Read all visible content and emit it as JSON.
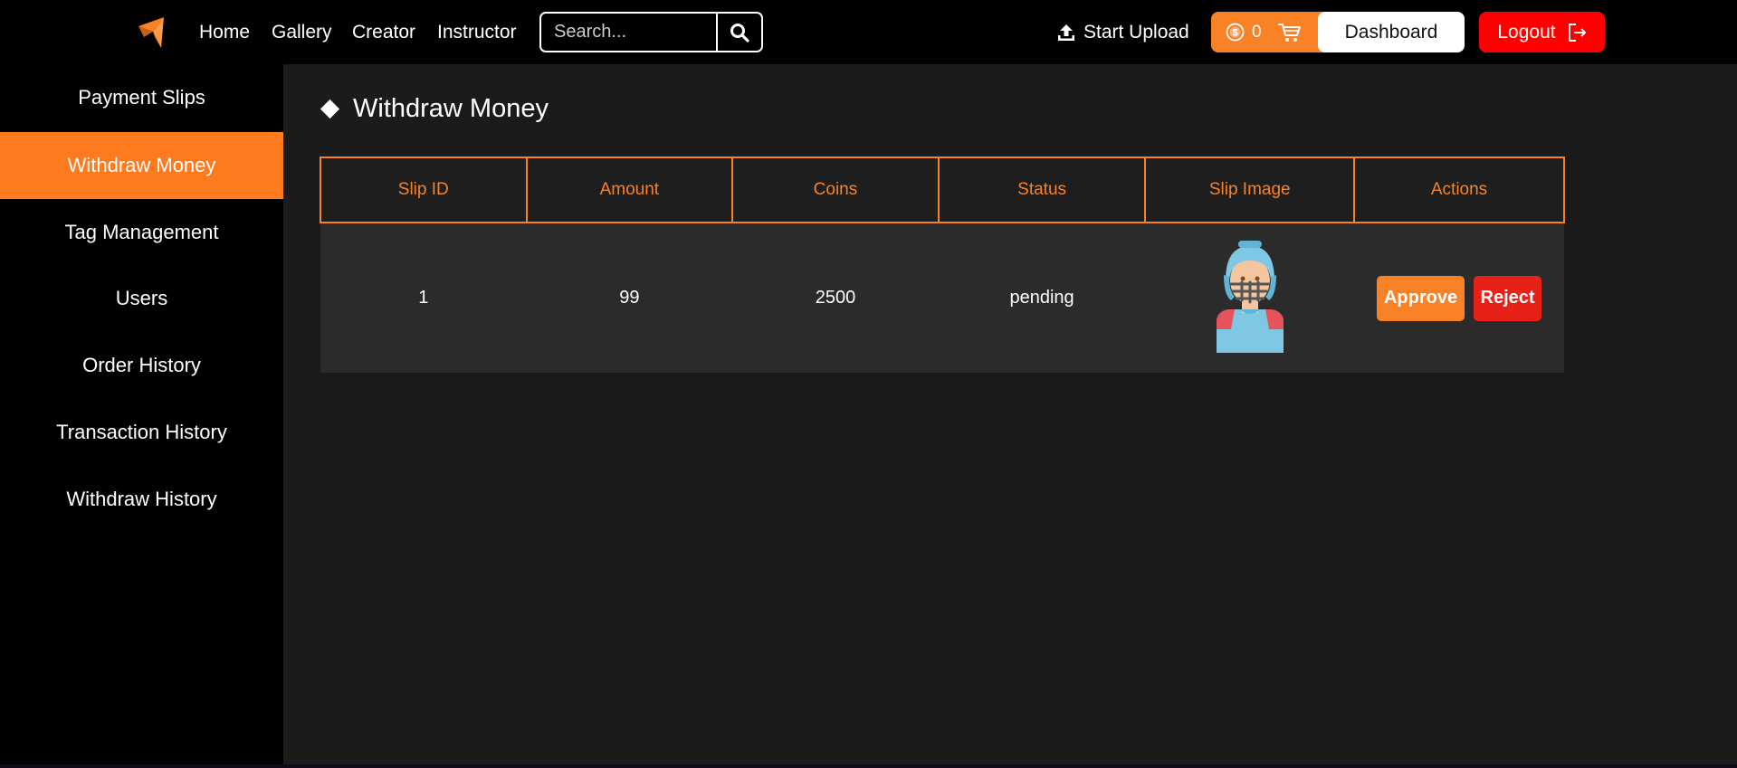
{
  "nav": {
    "links": [
      "Home",
      "Gallery",
      "Creator",
      "Instructor"
    ],
    "search_placeholder": "Search...",
    "upload_label": "Start Upload",
    "coin_count": "0",
    "dashboard_label": "Dashboard",
    "logout_label": "Logout"
  },
  "sidebar": {
    "items": [
      {
        "label": "Payment Slips",
        "active": false
      },
      {
        "label": "Withdraw Money",
        "active": true
      },
      {
        "label": "Tag Management",
        "active": false
      },
      {
        "label": "Users",
        "active": false
      },
      {
        "label": "Order History",
        "active": false
      },
      {
        "label": "Transaction History",
        "active": false
      },
      {
        "label": "Withdraw History",
        "active": false
      }
    ]
  },
  "main": {
    "title": "Withdraw Money",
    "table": {
      "headers": [
        "Slip ID",
        "Amount",
        "Coins",
        "Status",
        "Slip Image",
        "Actions"
      ],
      "rows": [
        {
          "slip_id": "1",
          "amount": "99",
          "coins": "2500",
          "status": "pending",
          "image_icon": "football-player-avatar",
          "approve_label": "Approve",
          "reject_label": "Reject"
        }
      ]
    }
  },
  "colors": {
    "accent": "#f98226",
    "logout": "#ff0000",
    "reject": "#e62117",
    "main_bg": "#1b1b1b",
    "row_bg": "#2b2b2b"
  }
}
